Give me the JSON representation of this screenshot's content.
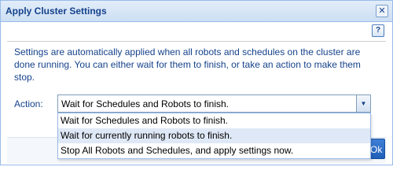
{
  "dialog": {
    "title": "Apply Cluster Settings",
    "close_glyph": "✕",
    "help_glyph": "?",
    "description": "Settings are automatically applied when all robots and schedules on the cluster are done running. You can either wait for them to finish, or take an action to make them stop.",
    "action": {
      "label": "Action:",
      "selected": "Wait for Schedules and Robots to finish.",
      "trigger_glyph": "▼",
      "options": [
        "Wait for Schedules and Robots to finish.",
        "Wait for currently running robots to finish.",
        "Stop All Robots and Schedules, and apply settings now."
      ],
      "highlighted_index": 1
    },
    "ok_label": "Ok"
  },
  "colors": {
    "title_text": "#15428b",
    "border": "#99bbe8",
    "highlight": "#dfe8f6",
    "ok_button": "#1f5fb8"
  },
  "icons": {
    "close": "close-icon",
    "help": "help-icon",
    "dropdown": "chevron-down-icon"
  }
}
